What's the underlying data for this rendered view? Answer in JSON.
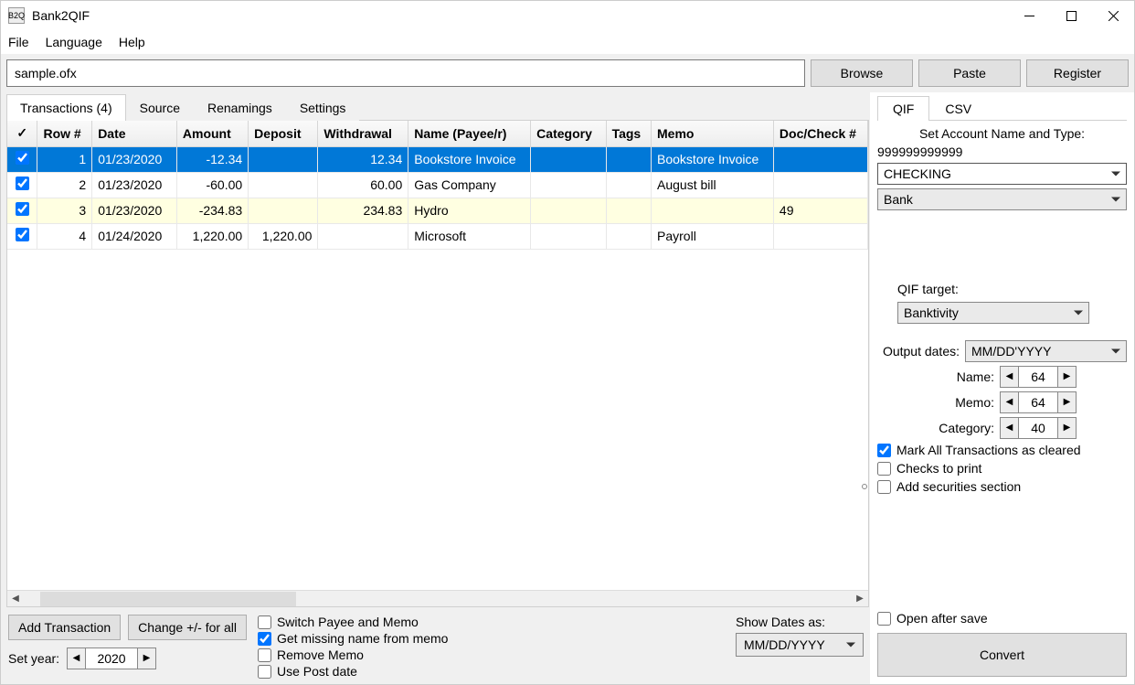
{
  "titlebar": {
    "title": "Bank2QIF"
  },
  "menubar": {
    "file": "File",
    "language": "Language",
    "help": "Help"
  },
  "toolbar": {
    "path": "sample.ofx",
    "browse": "Browse",
    "paste": "Paste",
    "register": "Register"
  },
  "tabs": {
    "transactions": "Transactions (4)",
    "source": "Source",
    "renamings": "Renamings",
    "settings": "Settings"
  },
  "columns": [
    "✓",
    "Row #",
    "Date",
    "Amount",
    "Deposit",
    "Withdrawal",
    "Name (Payee/r)",
    "Category",
    "Tags",
    "Memo",
    "Doc/Check #"
  ],
  "rows": [
    {
      "checked": true,
      "selected": true,
      "hl": false,
      "row": "1",
      "date": "01/23/2020",
      "amount": "-12.34",
      "deposit": "",
      "withdrawal": "12.34",
      "name": "Bookstore Invoice",
      "category": "",
      "tags": "",
      "memo": "Bookstore Invoice",
      "doc": ""
    },
    {
      "checked": true,
      "selected": false,
      "hl": false,
      "row": "2",
      "date": "01/23/2020",
      "amount": "-60.00",
      "deposit": "",
      "withdrawal": "60.00",
      "name": "Gas Company",
      "category": "",
      "tags": "",
      "memo": "August bill",
      "doc": ""
    },
    {
      "checked": true,
      "selected": false,
      "hl": true,
      "row": "3",
      "date": "01/23/2020",
      "amount": "-234.83",
      "deposit": "",
      "withdrawal": "234.83",
      "name": "Hydro",
      "category": "",
      "tags": "",
      "memo": "",
      "doc": "49"
    },
    {
      "checked": true,
      "selected": false,
      "hl": false,
      "row": "4",
      "date": "01/24/2020",
      "amount": "1,220.00",
      "deposit": "1,220.00",
      "withdrawal": "",
      "name": "Microsoft",
      "category": "",
      "tags": "",
      "memo": "Payroll",
      "doc": ""
    }
  ],
  "bottom": {
    "add": "Add Transaction",
    "change": "Change +/- for all",
    "setyear_label": "Set year:",
    "setyear_value": "2020",
    "chk_switch": "Switch Payee and Memo",
    "chk_getmissing": "Get missing name from memo",
    "chk_removememo": "Remove Memo",
    "chk_postdate": "Use Post date",
    "showdates_label": "Show Dates as:",
    "showdates_value": "MM/DD/YYYY"
  },
  "right": {
    "tab_qif": "QIF",
    "tab_csv": "CSV",
    "set_account_label": "Set Account Name and Type:",
    "account_number": "999999999999",
    "account_name": "CHECKING",
    "account_type": "Bank",
    "qif_target_label": "QIF target:",
    "qif_target_value": "Banktivity",
    "output_dates_label": "Output dates:",
    "output_dates_value": "MM/DD'YYYY",
    "name_label": "Name:",
    "name_value": "64",
    "memo_label": "Memo:",
    "memo_value": "64",
    "category_label": "Category:",
    "category_value": "40",
    "chk_cleared": "Mark All Transactions as cleared",
    "chk_print": "Checks to print",
    "chk_securities": "Add securities section",
    "open_after": "Open after save",
    "convert": "Convert"
  }
}
